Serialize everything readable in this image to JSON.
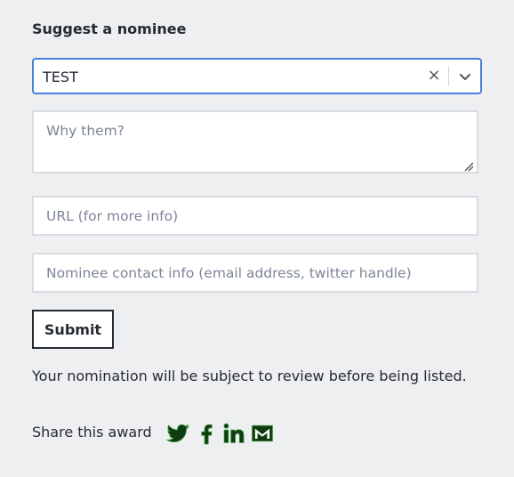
{
  "form": {
    "heading": "Suggest a nominee",
    "nominee_select": {
      "value": "TEST",
      "clear_glyph": "×"
    },
    "why_field": {
      "placeholder": "Why them?"
    },
    "url_field": {
      "placeholder": "URL (for more info)"
    },
    "contact_field": {
      "placeholder": "Nominee contact info (email address, twitter handle)"
    },
    "submit_label": "Submit",
    "review_note": "Your nomination will be subject to review before being listed."
  },
  "share": {
    "label": "Share this award",
    "icons": [
      "twitter-icon",
      "facebook-icon",
      "linkedin-icon",
      "email-icon"
    ],
    "icon_color": "#103b10",
    "icon_outline": "#2f8a2f"
  },
  "colors": {
    "background": "#eeeff1",
    "focus_border": "#4a7fe0",
    "field_border": "#d8dce1",
    "placeholder": "#7d8597",
    "text": "#262a33"
  }
}
